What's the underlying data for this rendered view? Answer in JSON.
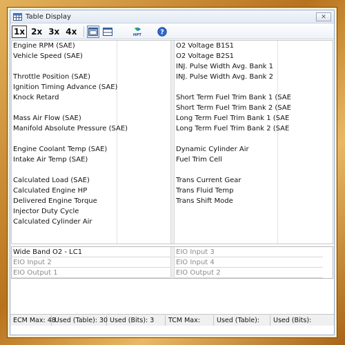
{
  "window": {
    "title": "Table Display",
    "close_label": "✕"
  },
  "toolbar": {
    "zoom": [
      "1x",
      "2x",
      "3x",
      "4x"
    ],
    "active_zoom": "1x"
  },
  "left_top": [
    "Engine RPM (SAE)",
    "Vehicle Speed (SAE)",
    "",
    "Throttle Position (SAE)",
    "Ignition Timing Advance (SAE)",
    "Knock Retard",
    "",
    "Mass Air Flow (SAE)",
    "Manifold Absolute Pressure (SAE)",
    "",
    "Engine Coolant Temp (SAE)",
    "Intake Air Temp (SAE)",
    "",
    "Calculated Load (SAE)",
    "Calculated Engine HP",
    "Delivered Engine Torque",
    "Injector Duty Cycle",
    "Calculated Cylinder Air"
  ],
  "right_top": [
    "O2 Voltage B1S1",
    "O2 Voltage B2S1",
    "INJ. Pulse Width Avg. Bank 1",
    "INJ. Pulse Width Avg. Bank 2",
    "",
    "Short Term Fuel Trim Bank 1 (SAE",
    "Short Term Fuel Trim Bank 2 (SAE",
    "Long Term Fuel Trim Bank 1 (SAE",
    "Long Term Fuel Trim Bank 2 (SAE",
    "",
    "Dynamic Cylinder Air",
    "Fuel Trim Cell",
    "",
    "Trans Current Gear",
    "Trans Fluid Temp",
    "Trans Shift Mode",
    "",
    ""
  ],
  "bottom": {
    "left": [
      "Wide Band O2 - LC1",
      "EIO Input 2",
      "EIO Output 1"
    ],
    "right": [
      "EIO Input 3",
      "EIO Input 4",
      "EIO Output 2"
    ]
  },
  "status": {
    "ecm_max": "ECM Max: 48",
    "ecm_used_table": "Used (Table): 30",
    "ecm_used_bits": "Used (Bits): 3",
    "tcm_max": "TCM Max:",
    "tcm_used_table": "Used (Table):",
    "tcm_used_bits": "Used (Bits):"
  },
  "icons": {
    "title": "table-grid-icon",
    "layout1": "single-panel-layout-icon",
    "layout2": "split-panel-layout-icon",
    "hpt": "hpt-logo-icon",
    "help": "help-icon"
  }
}
